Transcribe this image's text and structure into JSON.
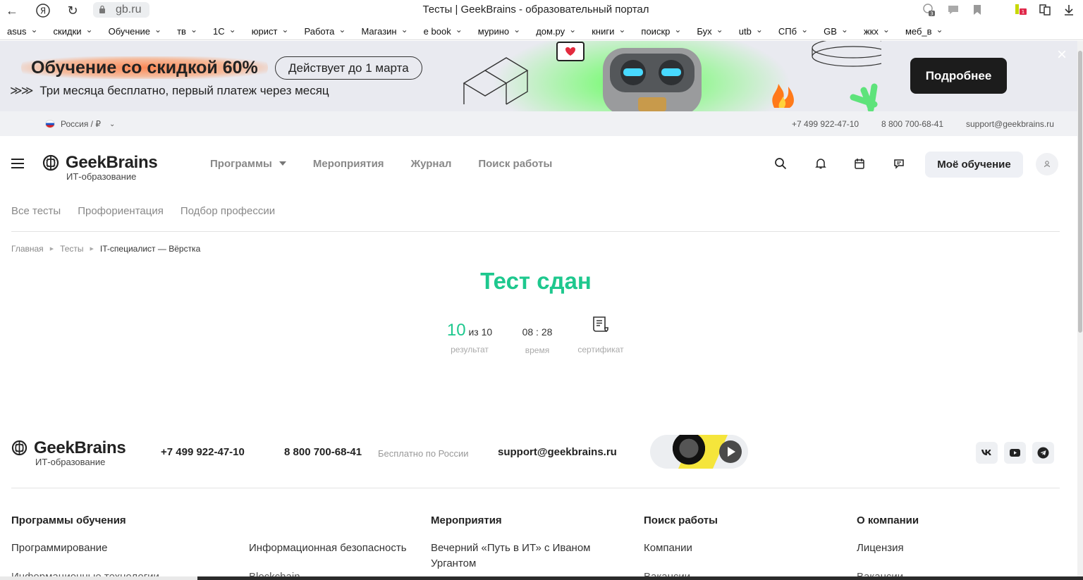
{
  "browser": {
    "url": "gb.ru",
    "title": "Тесты | GeekBrains - образовательный портал",
    "bookmarks": [
      "asus",
      "скидки",
      "Обучение",
      "тв",
      "1С",
      "юрист",
      "Работа",
      "Магазин",
      "e book",
      "мурино",
      "дом.ру",
      "книги",
      "поискр",
      "Бух",
      "utb",
      "СПб",
      "GB",
      "жкх",
      "меб_в"
    ],
    "badges": {
      "downloads_count": "3",
      "ext_badge": "1"
    }
  },
  "promo": {
    "headline": "Обучение со скидкой 60%",
    "pill": "Действует до 1 марта",
    "subline": "Три месяца бесплатно, первый платеж через месяц",
    "arrows": "≫≫",
    "button": "Подробнее",
    "close": "×"
  },
  "region_bar": {
    "region": "Россия / ₽",
    "phone1": "+7 499 922-47-10",
    "phone2": "8 800 700-68-41",
    "email": "support@geekbrains.ru"
  },
  "header": {
    "logo_name": "GeekBrains",
    "logo_sub": "ИТ-образование",
    "nav": [
      "Программы",
      "Мероприятия",
      "Журнал",
      "Поиск работы"
    ],
    "my_learning": "Моё обучение"
  },
  "subnav": [
    "Все тесты",
    "Профориентация",
    "Подбор профессии"
  ],
  "breadcrumb": {
    "items": [
      "Главная",
      "Тесты"
    ],
    "current": "IT-специалист — Вёрстка"
  },
  "result": {
    "title": "Тест сдан",
    "score": "10",
    "score_total": "из 10",
    "score_label": "результат",
    "time": "08 : 28",
    "time_label": "время",
    "cert_label": "сертификат"
  },
  "footer": {
    "logo_name": "GeekBrains",
    "logo_sub": "ИТ-образование",
    "phone1": "+7 499 922-47-10",
    "phone2": "8 800 700-68-41",
    "phone2_note": "Бесплатно по России",
    "email": "support@geekbrains.ru",
    "social": [
      "vk",
      "youtube",
      "telegram"
    ],
    "columns": {
      "programs": {
        "title": "Программы обучения",
        "links": [
          "Программирование",
          "Информационная безопасность",
          "Информационные технологии",
          "Blockchain"
        ]
      },
      "events": {
        "title": "Мероприятия",
        "links": [
          "Вечерний «Путь в ИТ» с Иваном Ургантом"
        ]
      },
      "jobs": {
        "title": "Поиск работы",
        "links": [
          "Компании",
          "Вакансии"
        ]
      },
      "company": {
        "title": "О компании",
        "links": [
          "Лицензия",
          "Вакансии"
        ]
      }
    }
  }
}
